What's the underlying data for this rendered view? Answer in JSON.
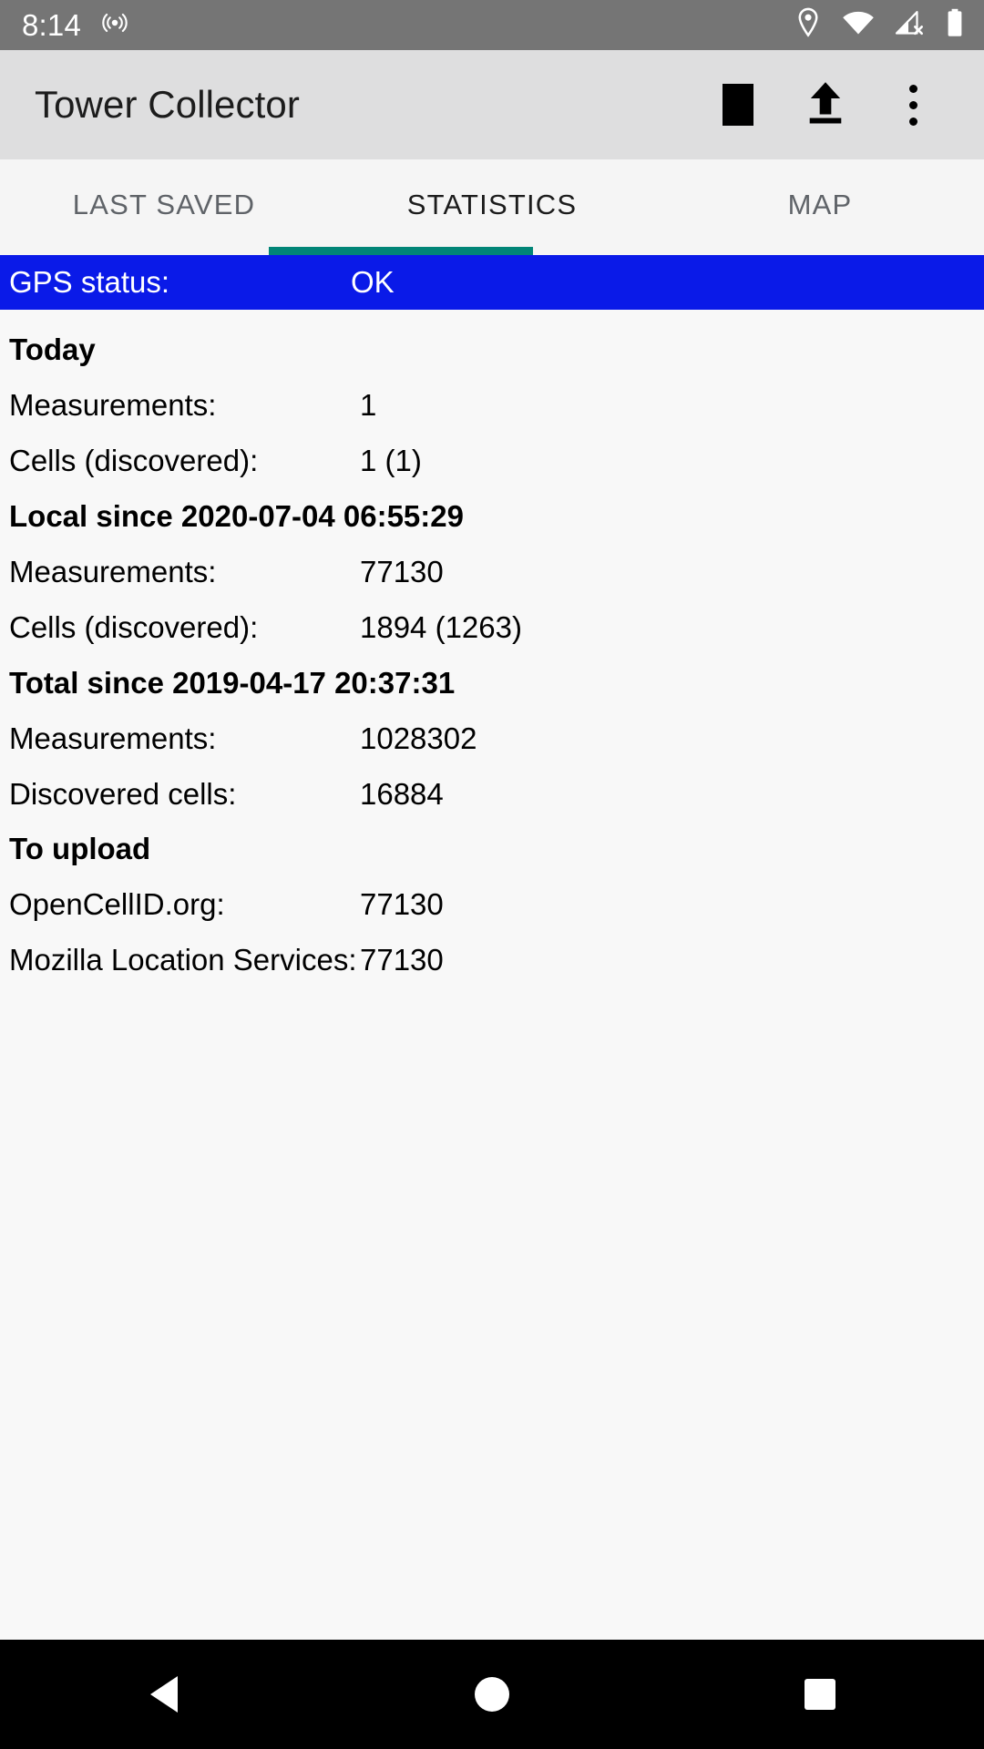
{
  "status_bar": {
    "clock": "8:14",
    "icons": {
      "cast": "broadcast-icon",
      "location": "location-pin-icon",
      "wifi": "wifi-icon",
      "cellular": "cellular-no-signal-icon",
      "battery": "battery-full-icon"
    },
    "background": "#757575"
  },
  "app_bar": {
    "title": "Tower Collector",
    "background": "#dededf",
    "actions": [
      {
        "name": "stop-collecting-button",
        "icon": "stop-square-icon"
      },
      {
        "name": "upload-button",
        "icon": "upload-arrow-icon"
      },
      {
        "name": "overflow-menu-button",
        "icon": "more-vertical-icon"
      }
    ]
  },
  "tabs": {
    "items": [
      {
        "label": "LAST SAVED",
        "active": false
      },
      {
        "label": "STATISTICS",
        "active": true
      },
      {
        "label": "MAP",
        "active": false
      }
    ],
    "indicator_color": "#018577",
    "active_index": 1
  },
  "gps": {
    "label": "GPS status:",
    "value": "OK",
    "background": "#0a1ae8",
    "text_color": "#ffffff"
  },
  "sections": [
    {
      "header": "Today",
      "rows": [
        {
          "key": "Measurements:",
          "value": "1"
        },
        {
          "key": "Cells (discovered):",
          "value": "1 (1)"
        }
      ]
    },
    {
      "header": "Local since 2020-07-04 06:55:29",
      "rows": [
        {
          "key": "Measurements:",
          "value": "77130"
        },
        {
          "key": "Cells (discovered):",
          "value": "1894 (1263)"
        }
      ]
    },
    {
      "header": "Total since 2019-04-17 20:37:31",
      "rows": [
        {
          "key": "Measurements:",
          "value": "1028302"
        },
        {
          "key": "Discovered cells:",
          "value": "16884"
        }
      ]
    },
    {
      "header": "To upload",
      "rows": [
        {
          "key": "OpenCellID.org:",
          "value": "77130"
        },
        {
          "key": "Mozilla Location Services:",
          "value": "77130"
        }
      ]
    }
  ],
  "nav_bar": {
    "background": "#000000",
    "buttons": [
      {
        "name": "nav-back-button",
        "icon": "back-triangle-icon"
      },
      {
        "name": "nav-home-button",
        "icon": "home-circle-icon"
      },
      {
        "name": "nav-recents-button",
        "icon": "recents-square-icon"
      }
    ]
  }
}
